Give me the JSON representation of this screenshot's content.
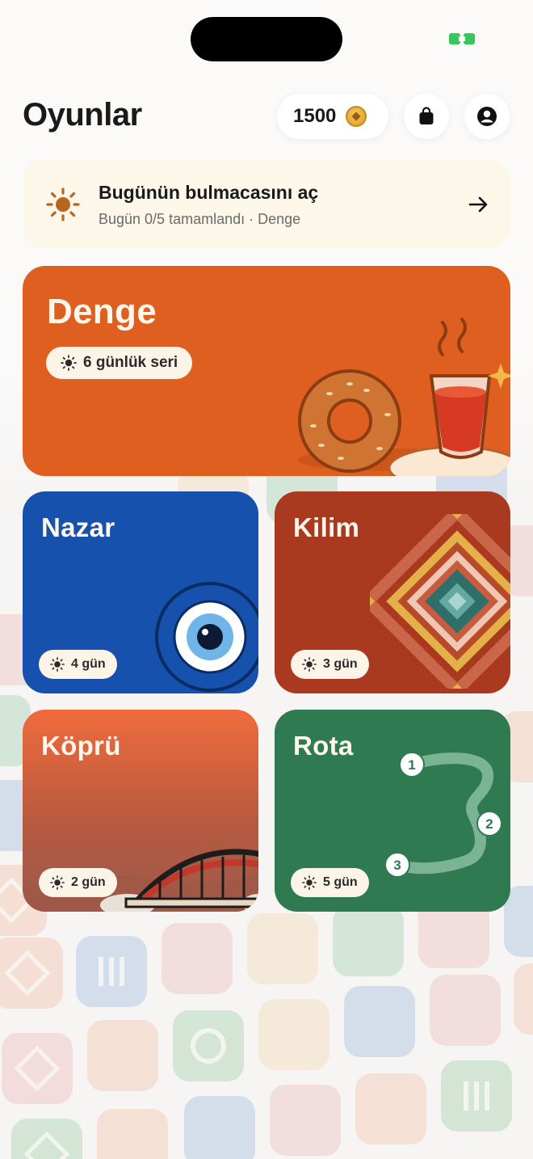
{
  "header": {
    "title": "Oyunlar",
    "coins": "1500"
  },
  "daily": {
    "title": "Bugünün bulmacasını aç",
    "subtitle": "Bugün 0/5 tamamlandı · Denge"
  },
  "games": {
    "denge": {
      "name": "Denge",
      "streak": "6 günlük seri"
    },
    "nazar": {
      "name": "Nazar",
      "streak": "4 gün"
    },
    "kilim": {
      "name": "Kilim",
      "streak": "3 gün"
    },
    "kopru": {
      "name": "Köprü",
      "streak": "2 gün"
    },
    "rota": {
      "name": "Rota",
      "streak": "5 gün",
      "route_points": [
        "1",
        "2",
        "3"
      ]
    }
  },
  "colors": {
    "denge": "#de5f1f",
    "nazar": "#1652ad",
    "kilim": "#a93a20",
    "rota": "#2f7a50",
    "battery": "#34c759"
  },
  "icons": [
    "sun-icon",
    "arrow-right-icon",
    "bag-icon",
    "profile-icon",
    "coin-icon"
  ]
}
